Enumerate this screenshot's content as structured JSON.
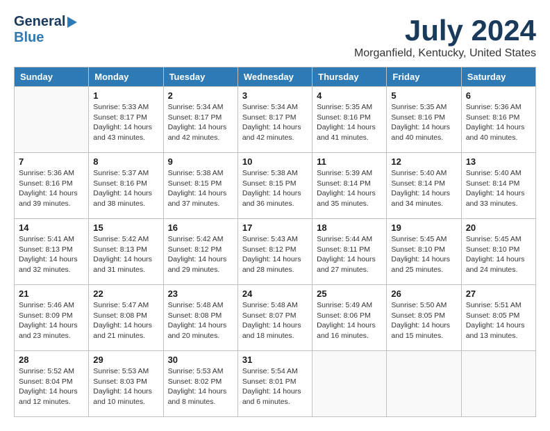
{
  "header": {
    "logo_general": "General",
    "logo_blue": "Blue",
    "month_year": "July 2024",
    "location": "Morganfield, Kentucky, United States"
  },
  "days_of_week": [
    "Sunday",
    "Monday",
    "Tuesday",
    "Wednesday",
    "Thursday",
    "Friday",
    "Saturday"
  ],
  "weeks": [
    [
      {
        "day": "",
        "sunrise": "",
        "sunset": "",
        "daylight": ""
      },
      {
        "day": "1",
        "sunrise": "Sunrise: 5:33 AM",
        "sunset": "Sunset: 8:17 PM",
        "daylight": "Daylight: 14 hours and 43 minutes."
      },
      {
        "day": "2",
        "sunrise": "Sunrise: 5:34 AM",
        "sunset": "Sunset: 8:17 PM",
        "daylight": "Daylight: 14 hours and 42 minutes."
      },
      {
        "day": "3",
        "sunrise": "Sunrise: 5:34 AM",
        "sunset": "Sunset: 8:17 PM",
        "daylight": "Daylight: 14 hours and 42 minutes."
      },
      {
        "day": "4",
        "sunrise": "Sunrise: 5:35 AM",
        "sunset": "Sunset: 8:16 PM",
        "daylight": "Daylight: 14 hours and 41 minutes."
      },
      {
        "day": "5",
        "sunrise": "Sunrise: 5:35 AM",
        "sunset": "Sunset: 8:16 PM",
        "daylight": "Daylight: 14 hours and 40 minutes."
      },
      {
        "day": "6",
        "sunrise": "Sunrise: 5:36 AM",
        "sunset": "Sunset: 8:16 PM",
        "daylight": "Daylight: 14 hours and 40 minutes."
      }
    ],
    [
      {
        "day": "7",
        "sunrise": "Sunrise: 5:36 AM",
        "sunset": "Sunset: 8:16 PM",
        "daylight": "Daylight: 14 hours and 39 minutes."
      },
      {
        "day": "8",
        "sunrise": "Sunrise: 5:37 AM",
        "sunset": "Sunset: 8:16 PM",
        "daylight": "Daylight: 14 hours and 38 minutes."
      },
      {
        "day": "9",
        "sunrise": "Sunrise: 5:38 AM",
        "sunset": "Sunset: 8:15 PM",
        "daylight": "Daylight: 14 hours and 37 minutes."
      },
      {
        "day": "10",
        "sunrise": "Sunrise: 5:38 AM",
        "sunset": "Sunset: 8:15 PM",
        "daylight": "Daylight: 14 hours and 36 minutes."
      },
      {
        "day": "11",
        "sunrise": "Sunrise: 5:39 AM",
        "sunset": "Sunset: 8:14 PM",
        "daylight": "Daylight: 14 hours and 35 minutes."
      },
      {
        "day": "12",
        "sunrise": "Sunrise: 5:40 AM",
        "sunset": "Sunset: 8:14 PM",
        "daylight": "Daylight: 14 hours and 34 minutes."
      },
      {
        "day": "13",
        "sunrise": "Sunrise: 5:40 AM",
        "sunset": "Sunset: 8:14 PM",
        "daylight": "Daylight: 14 hours and 33 minutes."
      }
    ],
    [
      {
        "day": "14",
        "sunrise": "Sunrise: 5:41 AM",
        "sunset": "Sunset: 8:13 PM",
        "daylight": "Daylight: 14 hours and 32 minutes."
      },
      {
        "day": "15",
        "sunrise": "Sunrise: 5:42 AM",
        "sunset": "Sunset: 8:13 PM",
        "daylight": "Daylight: 14 hours and 31 minutes."
      },
      {
        "day": "16",
        "sunrise": "Sunrise: 5:42 AM",
        "sunset": "Sunset: 8:12 PM",
        "daylight": "Daylight: 14 hours and 29 minutes."
      },
      {
        "day": "17",
        "sunrise": "Sunrise: 5:43 AM",
        "sunset": "Sunset: 8:12 PM",
        "daylight": "Daylight: 14 hours and 28 minutes."
      },
      {
        "day": "18",
        "sunrise": "Sunrise: 5:44 AM",
        "sunset": "Sunset: 8:11 PM",
        "daylight": "Daylight: 14 hours and 27 minutes."
      },
      {
        "day": "19",
        "sunrise": "Sunrise: 5:45 AM",
        "sunset": "Sunset: 8:10 PM",
        "daylight": "Daylight: 14 hours and 25 minutes."
      },
      {
        "day": "20",
        "sunrise": "Sunrise: 5:45 AM",
        "sunset": "Sunset: 8:10 PM",
        "daylight": "Daylight: 14 hours and 24 minutes."
      }
    ],
    [
      {
        "day": "21",
        "sunrise": "Sunrise: 5:46 AM",
        "sunset": "Sunset: 8:09 PM",
        "daylight": "Daylight: 14 hours and 23 minutes."
      },
      {
        "day": "22",
        "sunrise": "Sunrise: 5:47 AM",
        "sunset": "Sunset: 8:08 PM",
        "daylight": "Daylight: 14 hours and 21 minutes."
      },
      {
        "day": "23",
        "sunrise": "Sunrise: 5:48 AM",
        "sunset": "Sunset: 8:08 PM",
        "daylight": "Daylight: 14 hours and 20 minutes."
      },
      {
        "day": "24",
        "sunrise": "Sunrise: 5:48 AM",
        "sunset": "Sunset: 8:07 PM",
        "daylight": "Daylight: 14 hours and 18 minutes."
      },
      {
        "day": "25",
        "sunrise": "Sunrise: 5:49 AM",
        "sunset": "Sunset: 8:06 PM",
        "daylight": "Daylight: 14 hours and 16 minutes."
      },
      {
        "day": "26",
        "sunrise": "Sunrise: 5:50 AM",
        "sunset": "Sunset: 8:05 PM",
        "daylight": "Daylight: 14 hours and 15 minutes."
      },
      {
        "day": "27",
        "sunrise": "Sunrise: 5:51 AM",
        "sunset": "Sunset: 8:05 PM",
        "daylight": "Daylight: 14 hours and 13 minutes."
      }
    ],
    [
      {
        "day": "28",
        "sunrise": "Sunrise: 5:52 AM",
        "sunset": "Sunset: 8:04 PM",
        "daylight": "Daylight: 14 hours and 12 minutes."
      },
      {
        "day": "29",
        "sunrise": "Sunrise: 5:53 AM",
        "sunset": "Sunset: 8:03 PM",
        "daylight": "Daylight: 14 hours and 10 minutes."
      },
      {
        "day": "30",
        "sunrise": "Sunrise: 5:53 AM",
        "sunset": "Sunset: 8:02 PM",
        "daylight": "Daylight: 14 hours and 8 minutes."
      },
      {
        "day": "31",
        "sunrise": "Sunrise: 5:54 AM",
        "sunset": "Sunset: 8:01 PM",
        "daylight": "Daylight: 14 hours and 6 minutes."
      },
      {
        "day": "",
        "sunrise": "",
        "sunset": "",
        "daylight": ""
      },
      {
        "day": "",
        "sunrise": "",
        "sunset": "",
        "daylight": ""
      },
      {
        "day": "",
        "sunrise": "",
        "sunset": "",
        "daylight": ""
      }
    ]
  ]
}
